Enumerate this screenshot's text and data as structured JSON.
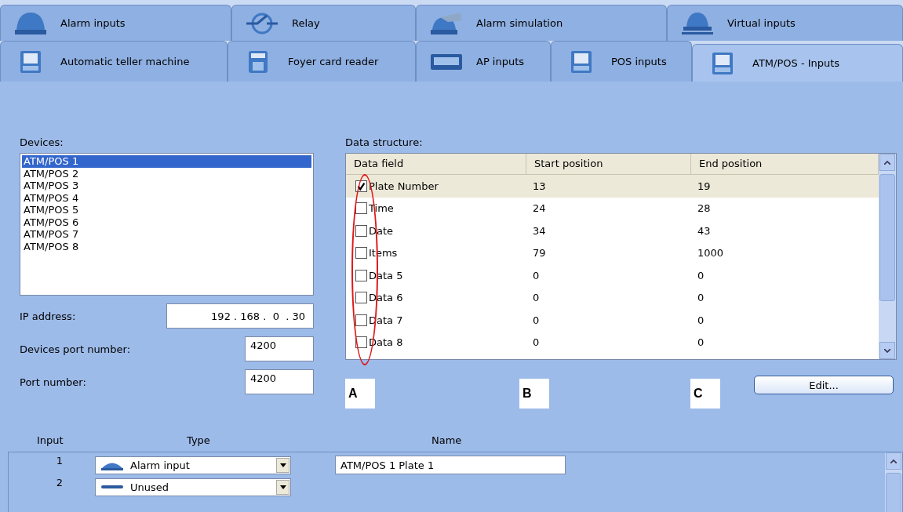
{
  "tab_rows": [
    [
      {
        "label": "Alarm inputs",
        "selected": false
      },
      {
        "label": "Relay",
        "selected": false
      },
      {
        "label": "Alarm simulation",
        "selected": false
      },
      {
        "label": "Virtual inputs",
        "selected": false
      }
    ],
    [
      {
        "label": "Automatic teller machine",
        "selected": false
      },
      {
        "label": "Foyer card reader",
        "selected": false
      },
      {
        "label": "AP inputs",
        "selected": false
      },
      {
        "label": "POS inputs",
        "selected": false
      },
      {
        "label": "ATM/POS - Inputs",
        "selected": true
      }
    ]
  ],
  "devices": {
    "label": "Devices:",
    "items": [
      {
        "label": "ATM/POS 1",
        "selected": true
      },
      {
        "label": "ATM/POS 2",
        "selected": false
      },
      {
        "label": "ATM/POS 3",
        "selected": false
      },
      {
        "label": "ATM/POS 4",
        "selected": false
      },
      {
        "label": "ATM/POS 5",
        "selected": false
      },
      {
        "label": "ATM/POS 6",
        "selected": false
      },
      {
        "label": "ATM/POS 7",
        "selected": false
      },
      {
        "label": "ATM/POS 8",
        "selected": false
      }
    ]
  },
  "ip": {
    "label": "IP address:",
    "value": "192 . 168 .  0  . 30"
  },
  "device_port": {
    "label": "Devices port number:",
    "value": "4200"
  },
  "port": {
    "label": "Port number:",
    "value": "4200"
  },
  "data_structure": {
    "label": "Data structure:",
    "columns": [
      "Data field",
      "Start position",
      "End position"
    ],
    "rows": [
      {
        "field": "Plate Number",
        "start": "13",
        "end": "19",
        "checked": true,
        "selected": true
      },
      {
        "field": "Time",
        "start": "24",
        "end": "28",
        "checked": false,
        "selected": false
      },
      {
        "field": "Date",
        "start": "34",
        "end": "43",
        "checked": false,
        "selected": false
      },
      {
        "field": "Items",
        "start": "79",
        "end": "1000",
        "checked": false,
        "selected": false
      },
      {
        "field": "Data 5",
        "start": "0",
        "end": "0",
        "checked": false,
        "selected": false
      },
      {
        "field": "Data 6",
        "start": "0",
        "end": "0",
        "checked": false,
        "selected": false
      },
      {
        "field": "Data 7",
        "start": "0",
        "end": "0",
        "checked": false,
        "selected": false
      },
      {
        "field": "Data 8",
        "start": "0",
        "end": "0",
        "checked": false,
        "selected": false
      }
    ]
  },
  "annotations": [
    "A",
    "B",
    "C"
  ],
  "edit_button": "Edit...",
  "inputs": {
    "columns": [
      "Input",
      "Type",
      "Name"
    ],
    "rows": [
      {
        "number": "1",
        "type": "Alarm input",
        "kind": "alarm",
        "name": "ATM/POS 1 Plate 1"
      },
      {
        "number": "2",
        "type": "Unused",
        "kind": "unused"
      }
    ]
  }
}
